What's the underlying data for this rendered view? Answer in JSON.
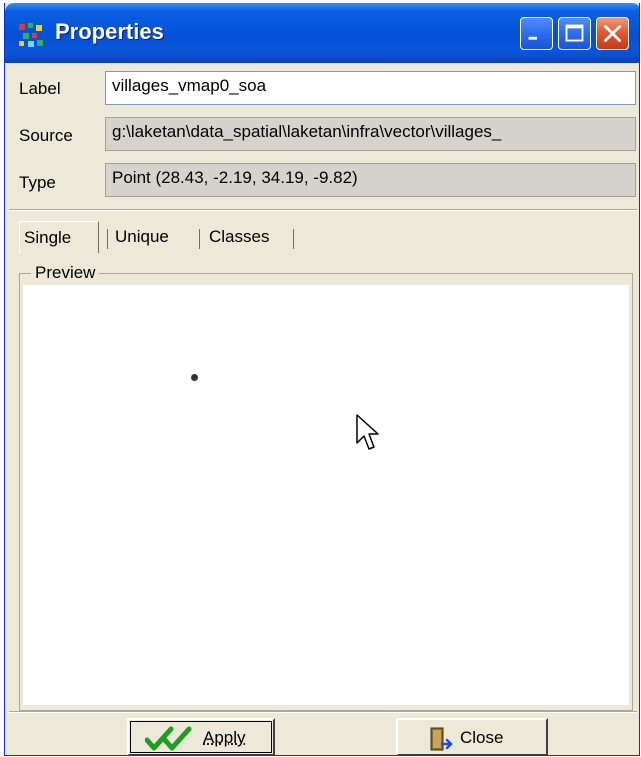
{
  "window": {
    "title": "Properties",
    "icon": "colorful-dots-app-icon",
    "controls": [
      "minimize-icon",
      "maximize-icon",
      "close-icon"
    ]
  },
  "fields": {
    "label": {
      "label": "Label",
      "value": "villages_vmap0_soa"
    },
    "source": {
      "label": "Source",
      "value": "g:\\laketan\\data_spatial\\laketan\\infra\\vector\\villages_"
    },
    "type": {
      "label": "Type",
      "value": "Point  (28.43, -2.19, 34.19, -9.82)"
    }
  },
  "tabs": [
    {
      "label": "Single",
      "selected": true
    },
    {
      "label": "Unique",
      "selected": false
    },
    {
      "label": "Classes",
      "selected": false
    }
  ],
  "preview": {
    "legend": "Preview"
  },
  "buttons": {
    "apply": {
      "label": "Apply",
      "icon": "double-check-icon"
    },
    "close": {
      "label": "Close",
      "icon": "door-exit-icon"
    }
  },
  "colors": {
    "titlebar": "#0450d6",
    "dialog_bg": "#ece9d8",
    "check_green": "#1f9d1f"
  }
}
